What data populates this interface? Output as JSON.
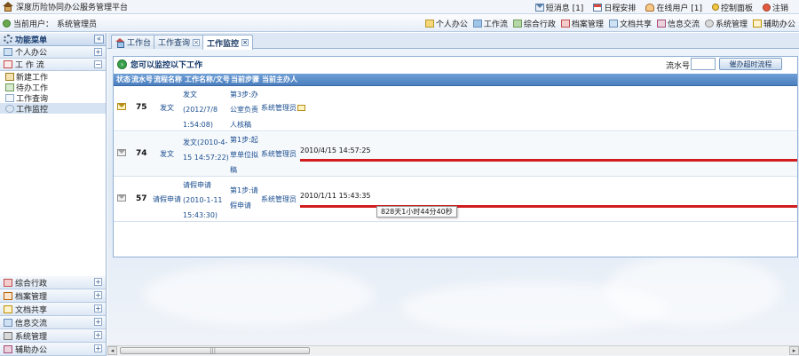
{
  "app": {
    "title": "深度历险协同办公服务管理平台"
  },
  "top_links": [
    {
      "label": "短消息 [1]",
      "icon": "mail-icon"
    },
    {
      "label": "日程安排",
      "icon": "calendar-icon"
    },
    {
      "label": "在线用户 [1]",
      "icon": "online-users-icon"
    },
    {
      "label": "控制面板",
      "icon": "key-icon"
    },
    {
      "label": "注销",
      "icon": "logout-icon"
    }
  ],
  "user_bar": {
    "label": "当前用户：",
    "name": "系统管理员"
  },
  "modules": [
    {
      "label": "个人办公",
      "icon": "personal-office-icon"
    },
    {
      "label": "工作流",
      "icon": "workflow-icon"
    },
    {
      "label": "综合行政",
      "icon": "admin-icon"
    },
    {
      "label": "档案管理",
      "icon": "archive-icon"
    },
    {
      "label": "文档共享",
      "icon": "document-share-icon"
    },
    {
      "label": "信息交流",
      "icon": "info-exchange-icon"
    },
    {
      "label": "系统管理",
      "icon": "system-admin-icon"
    },
    {
      "label": "辅助办公",
      "icon": "assist-office-icon"
    }
  ],
  "sidebar": {
    "header": "功能菜单",
    "collapse": "«",
    "top_sections": [
      {
        "label": "个人办公",
        "toggle": "+"
      },
      {
        "label": "工 作 流",
        "toggle": "−"
      }
    ],
    "workflow_items": [
      {
        "label": "新建工作"
      },
      {
        "label": "待办工作"
      },
      {
        "label": "工作查询"
      },
      {
        "label": "工作监控"
      }
    ],
    "bottom_sections": [
      {
        "label": "综合行政",
        "toggle": "+"
      },
      {
        "label": "档案管理",
        "toggle": "+"
      },
      {
        "label": "文档共享",
        "toggle": "+"
      },
      {
        "label": "信息交流",
        "toggle": "+"
      },
      {
        "label": "系统管理",
        "toggle": "+"
      },
      {
        "label": "辅助办公",
        "toggle": "+"
      }
    ]
  },
  "tabs": [
    {
      "label": "工作台"
    },
    {
      "label": "工作查询",
      "close": "×"
    },
    {
      "label": "工作监控",
      "close": "×"
    }
  ],
  "panel": {
    "title": "您可以监控以下工作",
    "serial_label": "流水号",
    "serial_value": "",
    "urge_button": "催办超时流程"
  },
  "table": {
    "columns": [
      "状态",
      "流水号",
      "流程名称",
      "工作名称/文号",
      "当前步骤",
      "当前主办人"
    ],
    "rows": [
      {
        "status": "open",
        "serial": "75",
        "flow": "发文",
        "work_name": "发文 (2012/7/8 1:54:08)",
        "step": "第3步:办公室负责人核稿",
        "handler": "系统管理员",
        "time": "",
        "progress": 0
      },
      {
        "status": "read",
        "serial": "74",
        "flow": "发文",
        "work_name": "发文(2010-4-15 14:57:22)",
        "step": "第1步:起草单位拟稿",
        "handler": "系统管理员",
        "time": "2010/4/15 14:57:25",
        "progress": 1
      },
      {
        "status": "read",
        "serial": "57",
        "flow": "请假申请",
        "work_name": "请假申请 (2010-1-11 15:43:30)",
        "step": "第1步:请假申请",
        "handler": "系统管理员",
        "time": "2010/1/11 15:43:35",
        "progress": 1
      }
    ]
  },
  "tooltip": "828天1小时44分40秒",
  "scrollbar": {
    "left": "◂",
    "right": "▸",
    "grip": "|||"
  },
  "colors": {
    "accent": "#4b7fbf",
    "overdue_bar": "#d11d1d",
    "link": "#1a4d8f"
  }
}
